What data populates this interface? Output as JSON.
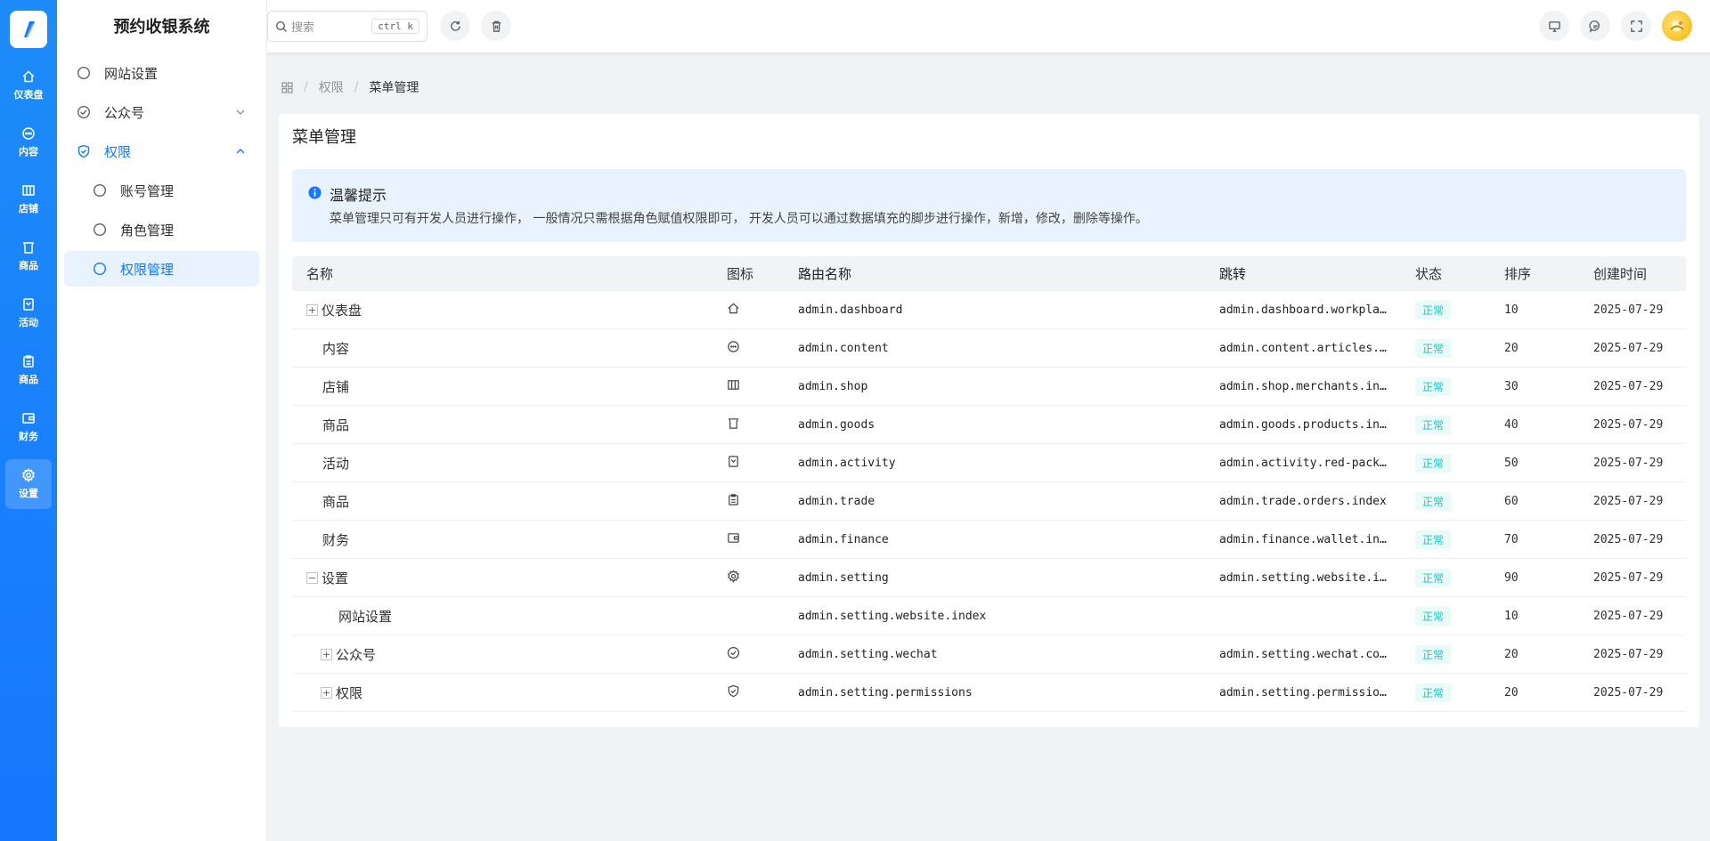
{
  "app": {
    "title": "预约收银系统"
  },
  "rail": {
    "items": [
      {
        "label": "仪表盘",
        "icon": "home-icon"
      },
      {
        "label": "内容",
        "icon": "chat-icon"
      },
      {
        "label": "店铺",
        "icon": "shop-icon"
      },
      {
        "label": "商品",
        "icon": "shirt-icon"
      },
      {
        "label": "活动",
        "icon": "bag-icon"
      },
      {
        "label": "商品",
        "icon": "clipboard-icon"
      },
      {
        "label": "财务",
        "icon": "wallet-icon"
      },
      {
        "label": "设置",
        "icon": "gear-icon"
      }
    ],
    "active_index": 7
  },
  "subnav": {
    "website": "网站设置",
    "wechat": "公众号",
    "permissions": "权限",
    "account": "账号管理",
    "role": "角色管理",
    "perm_mgmt": "权限管理"
  },
  "header": {
    "search_placeholder": "搜索",
    "search_shortcut": "ctrl k"
  },
  "breadcrumb": {
    "sep1": "/",
    "item1": "权限",
    "sep2": "/",
    "current": "菜单管理"
  },
  "page": {
    "title": "菜单管理"
  },
  "alert": {
    "title": "温馨提示",
    "desc": "菜单管理只可有开发人员进行操作， 一般情况只需根据角色赋值权限即可， 开发人员可以通过数据填充的脚步进行操作，新增，修改，删除等操作。"
  },
  "table": {
    "columns": {
      "name": "名称",
      "icon": "图标",
      "route": "路由名称",
      "jump": "跳转",
      "status": "状态",
      "sort": "排序",
      "created": "创建时间"
    },
    "rows": [
      {
        "name": "仪表盘",
        "icon": "home-icon",
        "route": "admin.dashboard",
        "jump": "admin.dashboard.workpla…",
        "status": "正常",
        "sort": "10",
        "created": "2025-07-29"
      },
      {
        "name": "内容",
        "icon": "chat-icon",
        "route": "admin.content",
        "jump": "admin.content.articles.…",
        "status": "正常",
        "sort": "20",
        "created": "2025-07-29"
      },
      {
        "name": "店铺",
        "icon": "shop-icon",
        "route": "admin.shop",
        "jump": "admin.shop.merchants.in…",
        "status": "正常",
        "sort": "30",
        "created": "2025-07-29"
      },
      {
        "name": "商品",
        "icon": "shirt-icon",
        "route": "admin.goods",
        "jump": "admin.goods.products.in…",
        "status": "正常",
        "sort": "40",
        "created": "2025-07-29"
      },
      {
        "name": "活动",
        "icon": "bag-icon",
        "route": "admin.activity",
        "jump": "admin.activity.red-pack…",
        "status": "正常",
        "sort": "50",
        "created": "2025-07-29"
      },
      {
        "name": "商品",
        "icon": "clipboard-icon",
        "route": "admin.trade",
        "jump": "admin.trade.orders.index",
        "status": "正常",
        "sort": "60",
        "created": "2025-07-29"
      },
      {
        "name": "财务",
        "icon": "wallet-icon",
        "route": "admin.finance",
        "jump": "admin.finance.wallet.in…",
        "status": "正常",
        "sort": "70",
        "created": "2025-07-29"
      },
      {
        "name": "设置",
        "icon": "gear-icon",
        "route": "admin.setting",
        "jump": "admin.setting.website.i…",
        "status": "正常",
        "sort": "90",
        "created": "2025-07-29"
      },
      {
        "name": "网站设置",
        "icon": "",
        "route": "admin.setting.website.index",
        "jump": "",
        "status": "正常",
        "sort": "10",
        "created": "2025-07-29"
      },
      {
        "name": "公众号",
        "icon": "check-circle-icon",
        "route": "admin.setting.wechat",
        "jump": "admin.setting.wechat.co…",
        "status": "正常",
        "sort": "20",
        "created": "2025-07-29"
      },
      {
        "name": "权限",
        "icon": "shield-check-icon",
        "route": "admin.setting.permissions",
        "jump": "admin.setting.permissio…",
        "status": "正常",
        "sort": "20",
        "created": "2025-07-29"
      }
    ]
  },
  "colors": {
    "primary": "#1677ff",
    "status_text": "#14c9c9",
    "status_bg": "#e8fbf7",
    "alert_bg": "#e8f3ff"
  }
}
